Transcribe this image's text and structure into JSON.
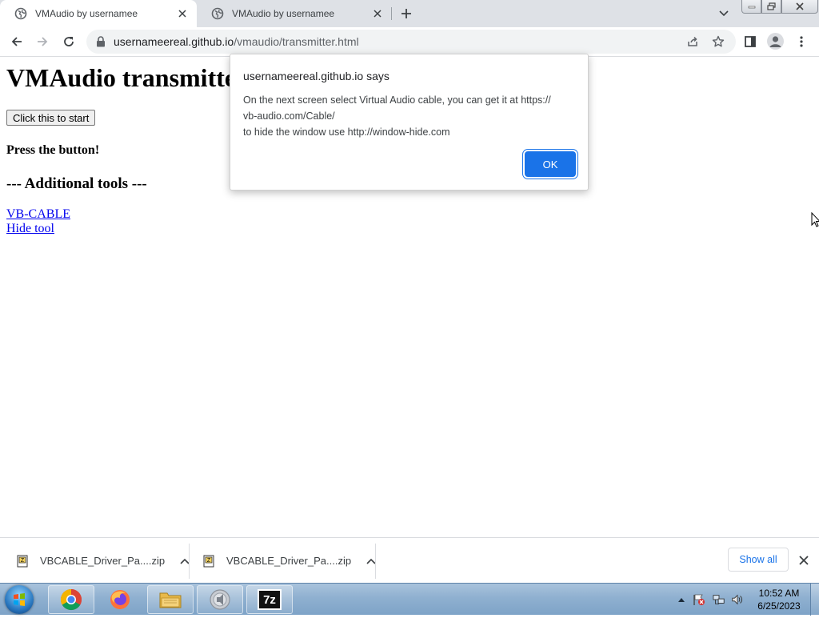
{
  "browser": {
    "tabs": [
      {
        "title": "VMAudio by usernamee",
        "active": true
      },
      {
        "title": "VMAudio by usernamee",
        "active": false
      }
    ],
    "url": {
      "host": "usernameereal.github.io",
      "path": "/vmaudio/transmitter.html"
    }
  },
  "page": {
    "heading": "VMAudio transmitter",
    "start_button": "Click this to start",
    "press_text": "Press the button!",
    "tools_heading": "--- Additional tools ---",
    "links": [
      "VB-CABLE",
      "Hide tool"
    ]
  },
  "alert": {
    "title": "usernameereal.github.io says",
    "lines": [
      "On the next screen select Virtual Audio cable, you can get it at https://",
      "vb-audio.com/Cable/",
      "to hide the window use http://window-hide.com"
    ],
    "ok_label": "OK"
  },
  "downloads": {
    "items": [
      {
        "name": "VBCABLE_Driver_Pa....zip"
      },
      {
        "name": "VBCABLE_Driver_Pa....zip"
      }
    ],
    "show_all_label": "Show all"
  },
  "taskbar": {
    "apps": [
      "chrome-icon",
      "firefox-icon",
      "file-explorer-icon",
      "media-player-icon",
      "7zip-icon"
    ],
    "seven_zip_label": "7z",
    "time": "10:52 AM",
    "date": "6/25/2023"
  },
  "colors": {
    "accent": "#1a73e8",
    "link": "#0000ee",
    "tabstrip": "#dee1e6"
  }
}
